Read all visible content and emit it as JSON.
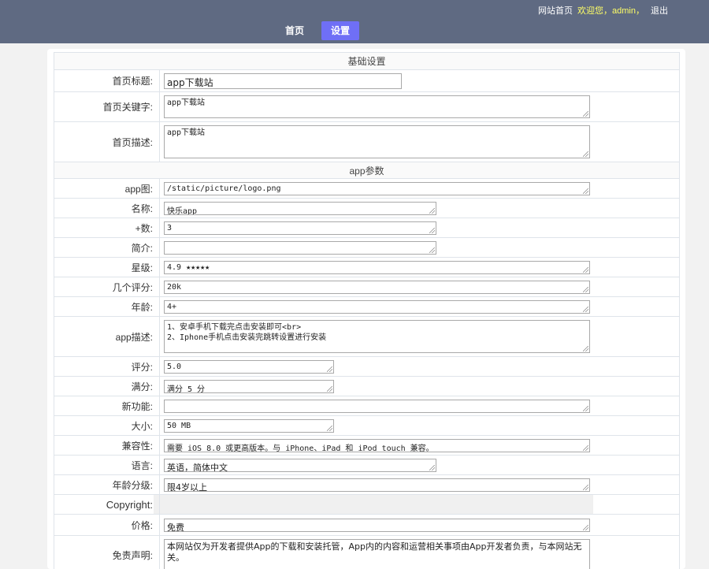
{
  "header": {
    "links": {
      "home": "网站首页",
      "welcome": "欢迎您，admin，",
      "logout": "退出"
    },
    "nav": [
      {
        "label": "首页"
      },
      {
        "label": "设置"
      }
    ]
  },
  "form": {
    "section_basic": "基础设置",
    "section_app": "app参数",
    "rows": {
      "title": {
        "label": "首页标题:",
        "value": "app下载站"
      },
      "keywords": {
        "label": "首页关键字:",
        "value": "app下载站"
      },
      "description": {
        "label": "首页描述:",
        "value": "app下载站"
      },
      "icon": {
        "label": "app图:",
        "value": "/static/picture/logo.png"
      },
      "name": {
        "label": "名称:",
        "value": "快乐app"
      },
      "plus": {
        "label": "+数:",
        "value": "3"
      },
      "intro": {
        "label": "简介:",
        "value": ""
      },
      "stars": {
        "label": "星级:",
        "value": "4.9 ★★★★★"
      },
      "ratings": {
        "label": "几个评分:",
        "value": "20k"
      },
      "age": {
        "label": "年龄:",
        "value": "4+"
      },
      "appdesc": {
        "label": "app描述:",
        "value": "1、安卓手机下载完点击安装即可<br>\n2、Iphone手机点击安装完跳转设置进行安装"
      },
      "score": {
        "label": "评分:",
        "value": "5.0"
      },
      "fullscore": {
        "label": "满分:",
        "value": "满分 5 分"
      },
      "newfeat": {
        "label": "新功能:",
        "value": ""
      },
      "size": {
        "label": "大小:",
        "value": "50 MB"
      },
      "compat": {
        "label": "兼容性:",
        "value": "需要 iOS 8.0 或更高版本。与 iPhone、iPad 和 iPod touch 兼容。"
      },
      "lang": {
        "label": "语言:",
        "value": "英语，简体中文"
      },
      "agerating": {
        "label": "年龄分级:",
        "value": "限4岁以上"
      },
      "copyright": {
        "label": "Copyright:",
        "value": ""
      },
      "price": {
        "label": "价格:",
        "value": "免费"
      },
      "disclaimer": {
        "label": "免责声明:",
        "value": "本网站仅为开发者提供App的下载和安装托管，App内的内容和运营相关事项由App开发者负责，与本网站无关。"
      }
    }
  }
}
